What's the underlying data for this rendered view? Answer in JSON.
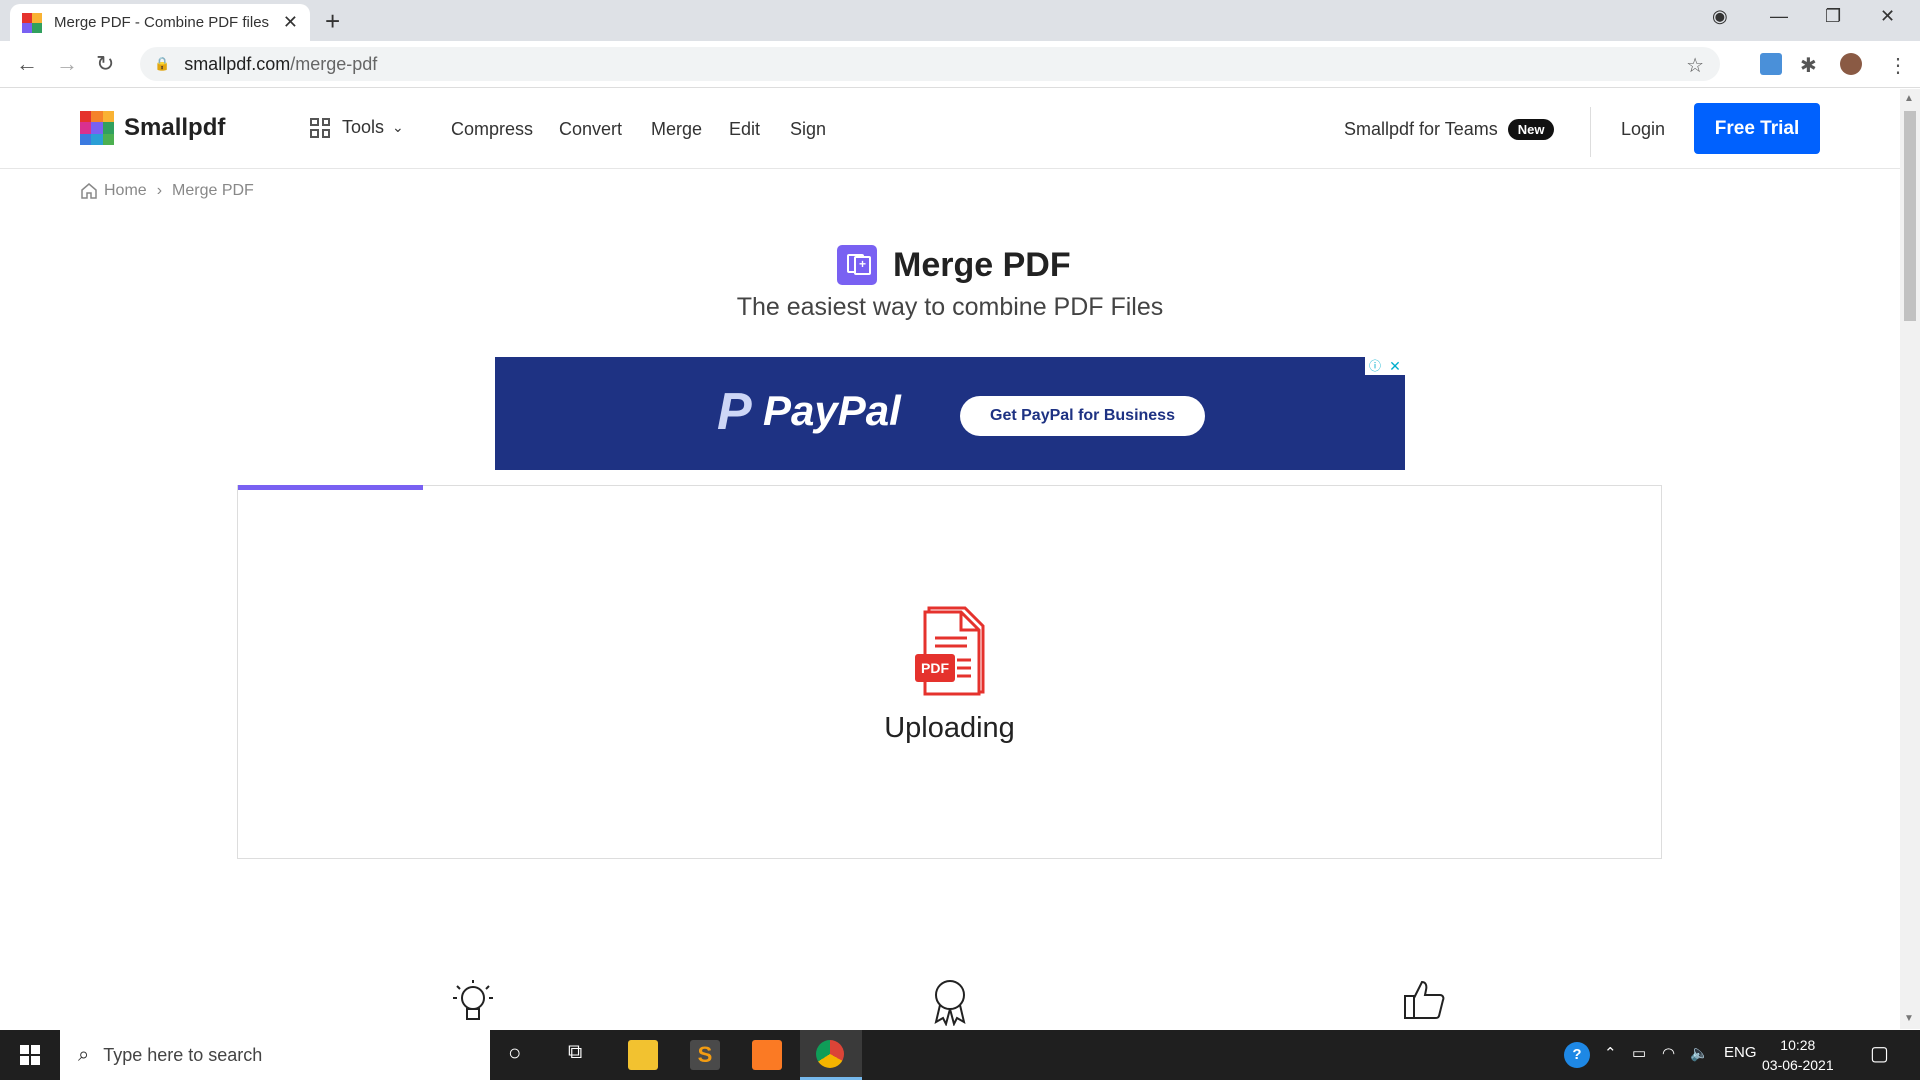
{
  "browser": {
    "tab_title": "Merge PDF - Combine PDF files o",
    "url_host": "smallpdf.com",
    "url_path": "/merge-pdf"
  },
  "header": {
    "logo_text": "Smallpdf",
    "tools_label": "Tools",
    "nav": [
      "Compress",
      "Convert",
      "Merge",
      "Edit",
      "Sign"
    ],
    "teams_label": "Smallpdf for Teams",
    "new_badge": "New",
    "login_label": "Login",
    "free_trial_label": "Free Trial"
  },
  "breadcrumb": {
    "home": "Home",
    "separator": "›",
    "current": "Merge PDF"
  },
  "page": {
    "title": "Merge PDF",
    "subtitle": "The easiest way to combine PDF Files",
    "accent_color": "#7961f2"
  },
  "ad": {
    "brand": "PayPal",
    "cta": "Get PayPal for Business"
  },
  "upload": {
    "status": "Uploading",
    "pdf_label": "PDF",
    "progress": 0.13
  },
  "taskbar": {
    "search_placeholder": "Type here to search",
    "language": "ENG",
    "time": "10:28",
    "date": "03-06-2021"
  }
}
